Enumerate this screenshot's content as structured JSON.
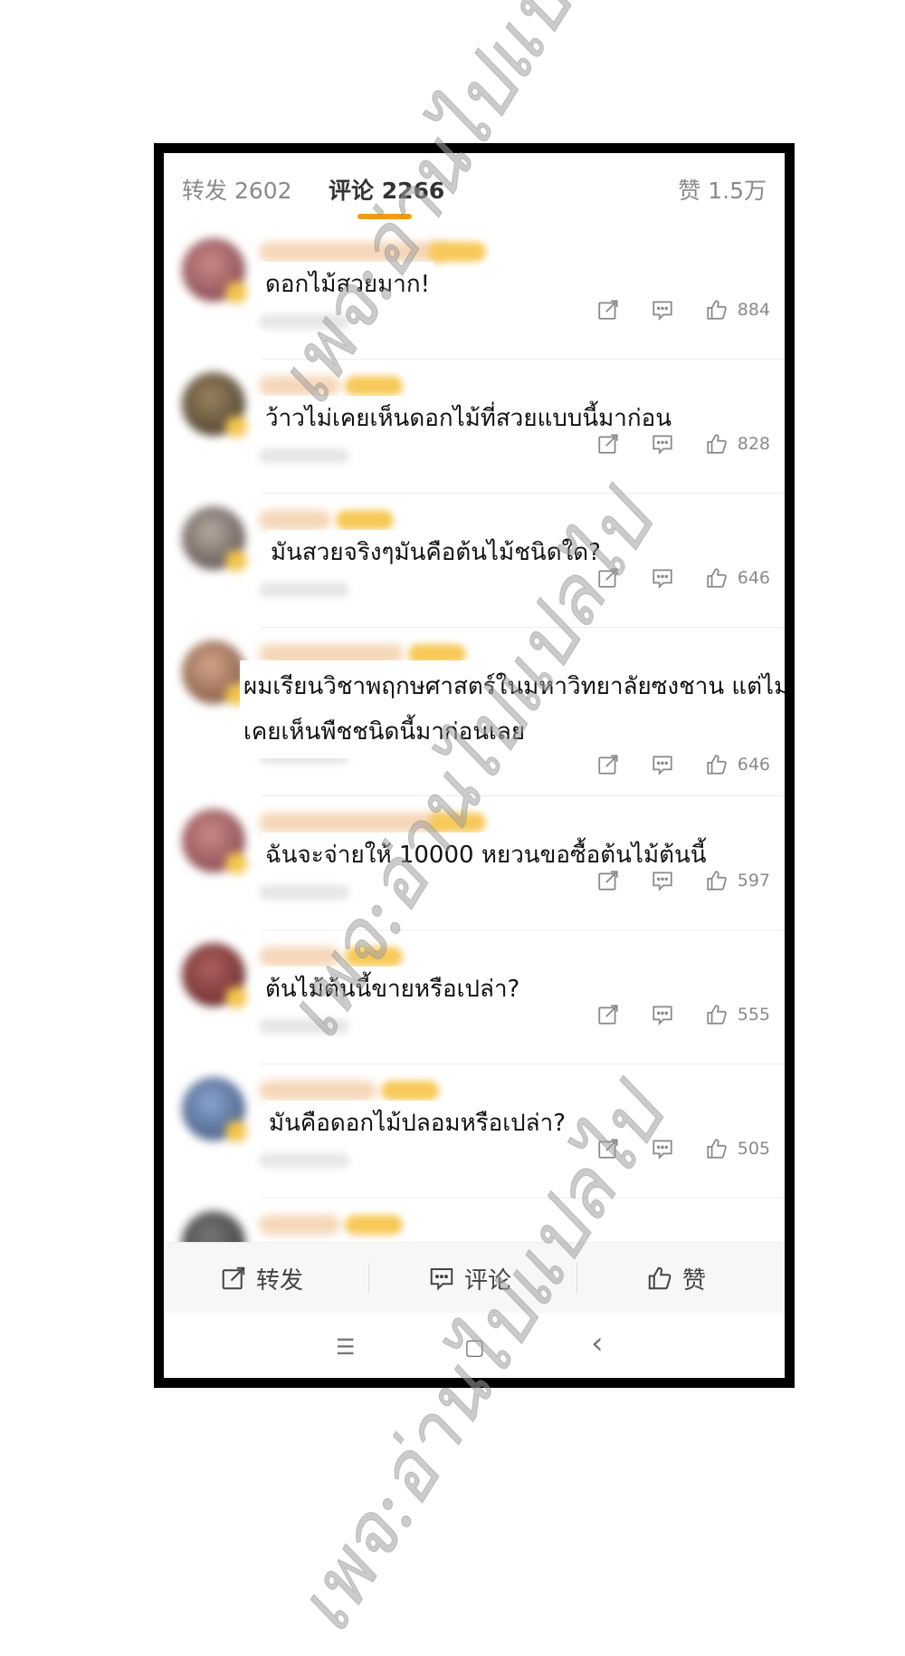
{
  "tabs": {
    "repost": "转发 2602",
    "comment_label": "评论",
    "comment_count": "2266",
    "like": "赞 1.5万"
  },
  "comments": [
    {
      "text": "ดอกไม้สวยมาก!",
      "likes": "884"
    },
    {
      "text": "ว้าวไม่เคยเห็นดอกไม้ที่สวยแบบนี้มาก่อน",
      "likes": "828"
    },
    {
      "text": "มันสวยจริงๆมันคือต้นไม้ชนิดใด?",
      "likes": "646"
    },
    {
      "text": "ผมเรียนวิชาพฤกษศาสตร์ในมหาวิทยาลัยซงชาน แต่ไม่เคยเห็นพืชชนิดนี้มาก่อนเลย",
      "likes": "646"
    },
    {
      "text": "ฉันจะจ่ายให้ 10000 หยวนขอซื้อต้นไม้ต้นนี้",
      "likes": "597"
    },
    {
      "text": "ต้นไม้ต้นนี้ขายหรือเปล่า?",
      "likes": "555"
    },
    {
      "text": "มันคือดอกไม้ปลอมหรือเปล่า?",
      "likes": "505"
    }
  ],
  "bottom_bar": {
    "repost": "转发",
    "comment": "评论",
    "like": "赞"
  },
  "nav": {
    "menu": "☰",
    "home": "▢",
    "back": "‹"
  },
  "watermark": "เพจ:อ่านไปแปลไป",
  "colors": {
    "accent": "#f29a15",
    "frame": "#000000"
  },
  "icons": [
    "share-icon",
    "comment-icon",
    "thumbs-up-icon"
  ]
}
